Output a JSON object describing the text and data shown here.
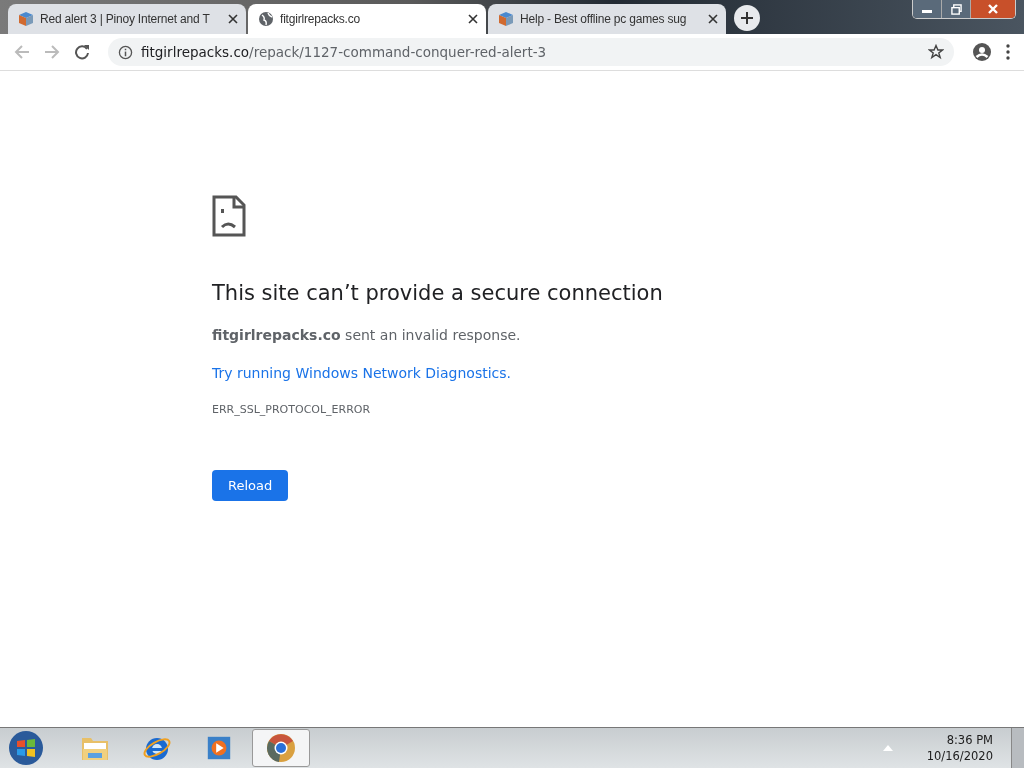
{
  "tabs": [
    {
      "title": "Red alert 3 | Pinoy Internet and T",
      "kind": "app",
      "selected": false
    },
    {
      "title": "fitgirlrepacks.co",
      "kind": "web",
      "selected": true
    },
    {
      "title": "Help - Best offline pc games sug",
      "kind": "app",
      "selected": false
    }
  ],
  "address_bar": {
    "host": "fitgirlrepacks.co",
    "path": "/repack/1127-command-conquer-red-alert-3"
  },
  "error_page": {
    "heading": "This site can’t provide a secure connection",
    "message": "**fitgirlrepacks.co** sent an invalid response.",
    "link": "Try running Windows Network Diagnostics.",
    "code": "ERR_SSL_PROTOCOL_ERROR",
    "button": "Reload"
  },
  "taskbar": {
    "items": [
      {
        "kind": "explorer",
        "selected": false
      },
      {
        "kind": "ie",
        "selected": false
      },
      {
        "kind": "media",
        "selected": false
      },
      {
        "kind": "chrome",
        "selected": true
      }
    ],
    "time": "8:36 PM",
    "date": "10/16/2020"
  }
}
